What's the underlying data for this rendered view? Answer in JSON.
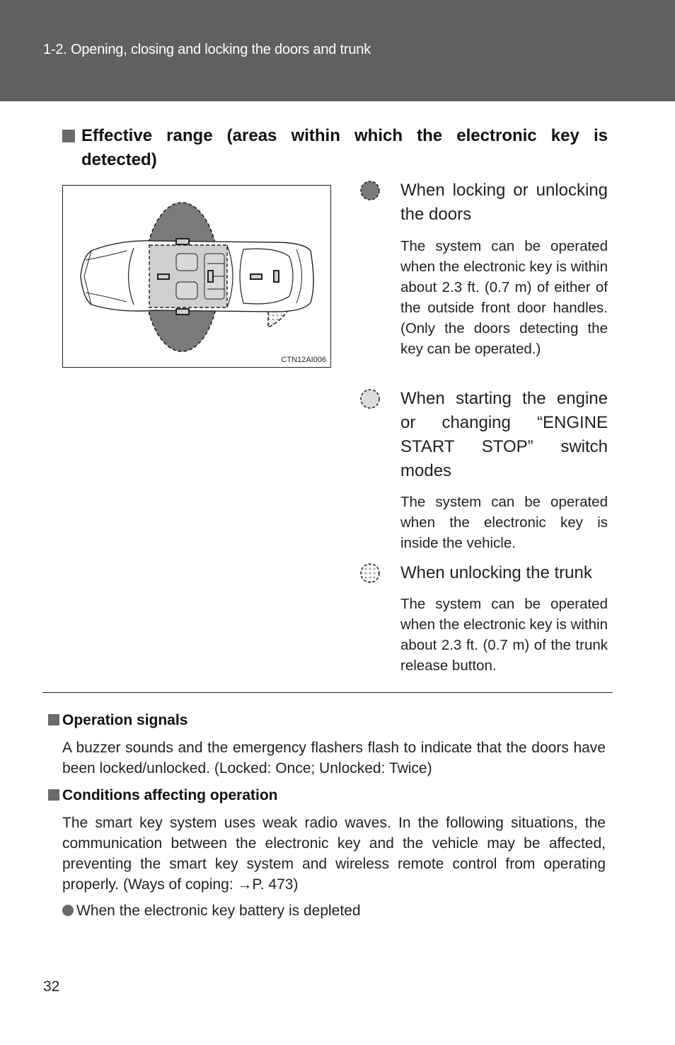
{
  "header": {
    "chapter_title": "1-2. Opening, closing and locking the doors and trunk",
    "background_color": "#5f6062"
  },
  "section": {
    "heading": "Effective range (areas within which the electronic key is detected)"
  },
  "figure": {
    "code": "CTN12AI006",
    "description": "Top view of vehicle showing key detection ranges around front doors (dark), cabin interior (light), and trunk (dotted)"
  },
  "legend": [
    {
      "icon": "dark-dashed-circle-icon",
      "title": "When locking or unlocking the doors",
      "description": "The system can be operated when the electronic key is within about 2.3 ft. (0.7 m) of either of the outside front door handles. (Only the doors detecting the key can be operated.)"
    },
    {
      "icon": "light-dashed-circle-icon",
      "title": "When starting the engine or changing “ENGINE START STOP” switch modes",
      "description": "The system can be operated when the electronic key is inside the vehicle."
    },
    {
      "icon": "dotted-circle-icon",
      "title": "When unlocking the trunk",
      "description": "The system can be operated when the electronic key is within about 2.3 ft. (0.7 m) of the trunk release button."
    }
  ],
  "notes": [
    {
      "heading": "Operation signals",
      "body": "A buzzer sounds and the emergency flashers flash to indicate that the doors have been locked/unlocked. (Locked: Once; Unlocked: Twice)"
    },
    {
      "heading": "Conditions affecting operation",
      "body": "The smart key system uses weak radio waves. In the following situations, the communication between the electronic key and the vehicle may be affected, preventing the smart key system and wireless remote control from operating properly. (Ways of coping: →P. 473)",
      "bullets": [
        "When the electronic key battery is depleted"
      ]
    }
  ],
  "footer": {
    "page_number": "32"
  }
}
